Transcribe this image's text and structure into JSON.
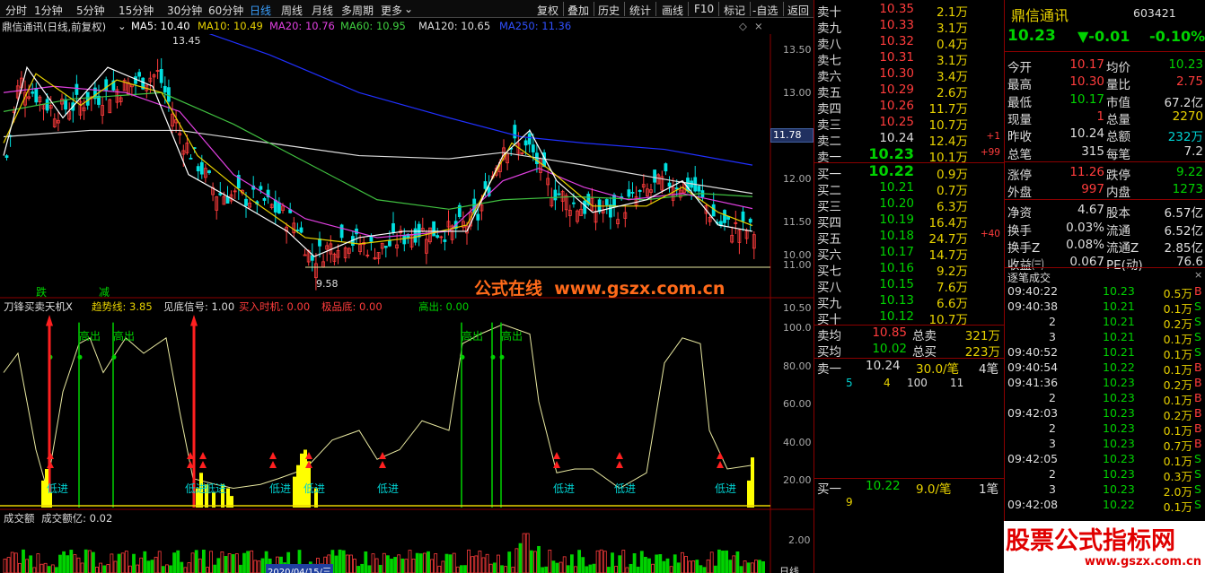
{
  "toolbar": {
    "items": [
      "分时",
      "1分钟",
      "5分钟",
      "15分钟",
      "30分钟",
      "60分钟",
      "日线",
      "周线",
      "月线",
      "多周期",
      "更多"
    ],
    "right": [
      "复权",
      "叠加",
      "历史",
      "统计",
      "画线",
      "F10",
      "标记",
      "-自选",
      "返回"
    ]
  },
  "chart_info": {
    "title": "鼎信通讯(日线,前复权)",
    "ma5": "MA5: 10.40",
    "ma10": "MA10: 10.49",
    "ma20": "MA20: 10.76",
    "ma60": "MA60: 10.95",
    "ma120": "MA120: 10.65",
    "ma250": "MA250: 11.36"
  },
  "price_axis": [
    "13.50",
    "13.00",
    "12.50",
    "12.00",
    "11.50",
    "11.00",
    "10.50",
    "10.00"
  ],
  "price_marker": "11.78",
  "annotations": {
    "high": "13.45",
    "low": "9.58",
    "die": "跌",
    "jian": "减",
    "watermark": "公式在线  www.gszx.com.cn"
  },
  "indicator": {
    "title": "刀锋买卖天机X",
    "trend": "趋势线: 3.85",
    "bottom": "见底信号: 1.00",
    "buy": "买入时机: 0.00",
    "extreme": "极品底: 0.00",
    "gaochu": "高出: 0.00",
    "axis": [
      "100.0",
      "80.00",
      "60.00",
      "40.00",
      "20.00"
    ],
    "high_label": "高出",
    "low_label": "低进"
  },
  "volume": {
    "title": "成交额",
    "sub": "成交额亿: 0.02",
    "axis": "2.00",
    "date": "2020/04/15/三",
    "period": "日线"
  },
  "orderbook": {
    "sell": [
      {
        "label": "卖十",
        "price": "10.35",
        "vol": "2.1万",
        "chg": ""
      },
      {
        "label": "卖九",
        "price": "10.33",
        "vol": "3.1万",
        "chg": ""
      },
      {
        "label": "卖八",
        "price": "10.32",
        "vol": "0.4万",
        "chg": ""
      },
      {
        "label": "卖七",
        "price": "10.31",
        "vol": "3.1万",
        "chg": ""
      },
      {
        "label": "卖六",
        "price": "10.30",
        "vol": "3.4万",
        "chg": ""
      },
      {
        "label": "卖五",
        "price": "10.29",
        "vol": "2.6万",
        "chg": ""
      },
      {
        "label": "卖四",
        "price": "10.26",
        "vol": "11.7万",
        "chg": ""
      },
      {
        "label": "卖三",
        "price": "10.25",
        "vol": "10.7万",
        "chg": ""
      },
      {
        "label": "卖二",
        "price": "10.24",
        "vol": "12.4万",
        "chg": "+1"
      },
      {
        "label": "卖一",
        "price": "10.23",
        "vol": "10.1万",
        "chg": "+99"
      }
    ],
    "buy": [
      {
        "label": "买一",
        "price": "10.22",
        "vol": "0.9万",
        "chg": ""
      },
      {
        "label": "买二",
        "price": "10.21",
        "vol": "0.7万",
        "chg": ""
      },
      {
        "label": "买三",
        "price": "10.20",
        "vol": "6.3万",
        "chg": ""
      },
      {
        "label": "买四",
        "price": "10.19",
        "vol": "16.4万",
        "chg": ""
      },
      {
        "label": "买五",
        "price": "10.18",
        "vol": "24.7万",
        "chg": "+40"
      },
      {
        "label": "买六",
        "price": "10.17",
        "vol": "14.7万",
        "chg": ""
      },
      {
        "label": "买七",
        "price": "10.16",
        "vol": "9.2万",
        "chg": ""
      },
      {
        "label": "买八",
        "price": "10.15",
        "vol": "7.6万",
        "chg": ""
      },
      {
        "label": "买九",
        "price": "10.13",
        "vol": "6.6万",
        "chg": ""
      },
      {
        "label": "买十",
        "price": "10.12",
        "vol": "10.7万",
        "chg": ""
      }
    ],
    "sell_avg": {
      "label": "卖均",
      "price": "10.85",
      "tl": "总卖",
      "tv": "321万"
    },
    "buy_avg": {
      "label": "买均",
      "price": "10.02",
      "tl": "总买",
      "tv": "223万"
    },
    "s1_detail": {
      "label": "卖一",
      "price": "10.24",
      "vol": "30.0/笔",
      "cnt": "4笔",
      "q": [
        "5",
        "4",
        "100",
        "11"
      ]
    },
    "b1_detail": {
      "label": "买一",
      "price": "10.22",
      "vol": "9.0/笔",
      "cnt": "1笔",
      "q": [
        "9"
      ]
    }
  },
  "quote": {
    "name": "鼎信通讯",
    "code": "603421",
    "price": "10.23",
    "change": "▼-0.01",
    "pct": "-0.10%",
    "rows": [
      [
        "今开",
        "10.17",
        "均价",
        "10.23"
      ],
      [
        "最高",
        "10.30",
        "量比",
        "2.75"
      ],
      [
        "最低",
        "10.17",
        "市值",
        "67.2亿"
      ],
      [
        "现量",
        "1",
        "总量",
        "2270"
      ],
      [
        "昨收",
        "10.24",
        "总额",
        "232万"
      ],
      [
        "总笔",
        "315",
        "每笔",
        "7.2"
      ],
      [
        "涨停",
        "11.26",
        "跌停",
        "9.22"
      ],
      [
        "外盘",
        "997",
        "内盘",
        "1273"
      ],
      [
        "净资",
        "4.67",
        "股本",
        "6.57亿"
      ],
      [
        "换手",
        "0.03%",
        "流通",
        "6.52亿"
      ],
      [
        "换手Z",
        "0.08%",
        "流通Z",
        "2.85亿"
      ],
      [
        "收益㈢",
        "0.067",
        "PE(动)",
        "76.6"
      ]
    ]
  },
  "ticks": {
    "title": "逐笔成交",
    "rows": [
      [
        "09:40:22",
        "10.23",
        "0.5万",
        "B"
      ],
      [
        "09:40:38",
        "10.21",
        "0.1万",
        "S"
      ],
      [
        "2",
        "10.21",
        "0.2万",
        "S"
      ],
      [
        "3",
        "10.21",
        "0.1万",
        "S"
      ],
      [
        "09:40:52",
        "10.21",
        "0.1万",
        "S"
      ],
      [
        "09:40:54",
        "10.22",
        "0.1万",
        "B"
      ],
      [
        "09:41:36",
        "10.23",
        "0.2万",
        "B"
      ],
      [
        "2",
        "10.23",
        "0.1万",
        "B"
      ],
      [
        "09:42:03",
        "10.23",
        "0.2万",
        "B"
      ],
      [
        "2",
        "10.23",
        "0.1万",
        "B"
      ],
      [
        "3",
        "10.23",
        "0.7万",
        "B"
      ],
      [
        "09:42:05",
        "10.23",
        "0.1万",
        "S"
      ],
      [
        "2",
        "10.23",
        "0.3万",
        "S"
      ],
      [
        "3",
        "10.23",
        "2.0万",
        "S"
      ],
      [
        "09:42:08",
        "10.22",
        "0.1万",
        "S"
      ]
    ]
  },
  "footer_watermark": "股票公式指标网",
  "footer_url": "www.gszx.com.cn",
  "colors": {
    "up": "#ff3c3c",
    "down": "#00d200",
    "yellow": "#e8d200",
    "cyan": "#00d2d2",
    "blue": "#3aa0ff"
  }
}
